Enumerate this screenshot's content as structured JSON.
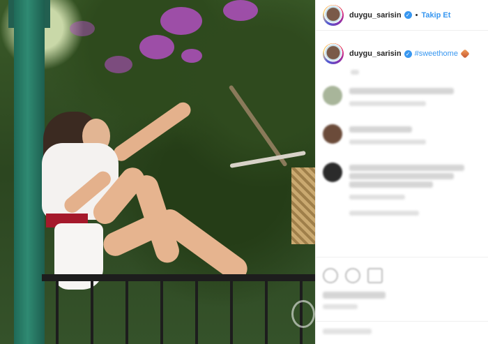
{
  "post": {
    "author": "duygu_sarisin",
    "follow_separator": "•",
    "follow_label": "Takip Et",
    "caption_hashtag": "#sweethome",
    "verified_mark": "✓"
  },
  "icons": {
    "verified": "verified-badge-icon",
    "emoji": "house-emoji-icon",
    "like": "heart-icon",
    "comment": "comment-icon",
    "share": "share-icon",
    "save": "bookmark-icon"
  },
  "colors": {
    "link": "#3897f0",
    "text": "#262626",
    "border": "#efefef"
  },
  "comments_count_visible": 3
}
